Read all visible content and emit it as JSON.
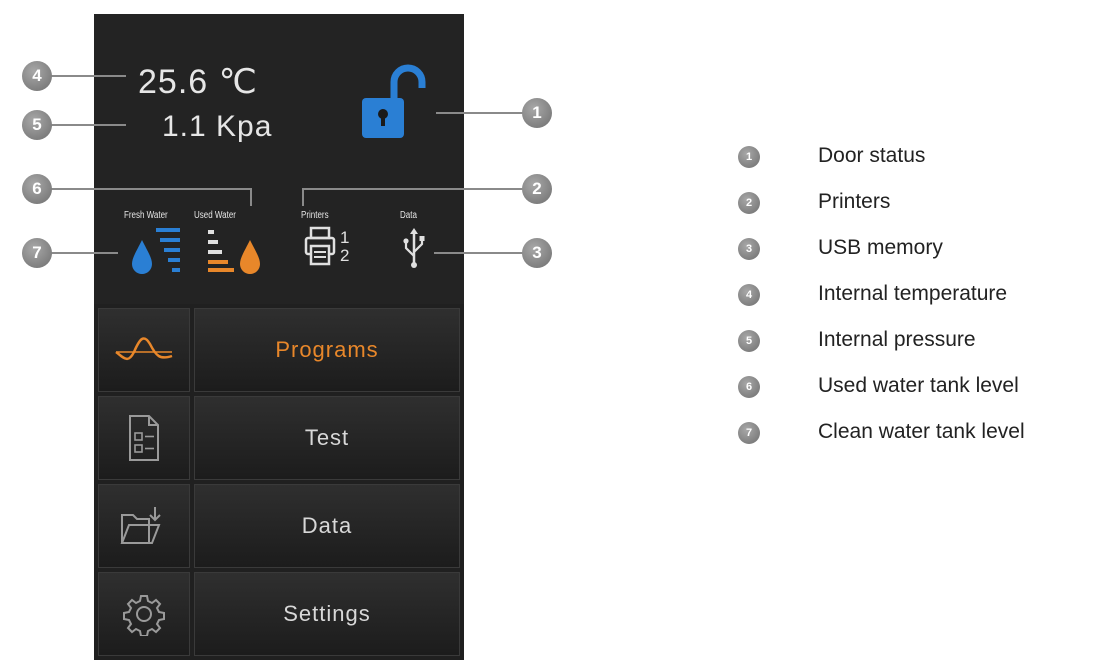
{
  "status": {
    "temperature": "25.6 ℃",
    "pressure": "1.1 Kpa",
    "fresh_water_label": "Fresh Water",
    "used_water_label": "Used Water",
    "printers_label": "Printers",
    "data_label": "Data",
    "printer_num_1": "1",
    "printer_num_2": "2"
  },
  "menu": {
    "items": [
      {
        "label": "Programs",
        "icon": "sine-wave-icon",
        "active": true
      },
      {
        "label": "Test",
        "icon": "checklist-document-icon",
        "active": false
      },
      {
        "label": "Data",
        "icon": "folder-download-icon",
        "active": false
      },
      {
        "label": "Settings",
        "icon": "gear-icon",
        "active": false
      }
    ]
  },
  "callouts": {
    "c1": "1",
    "c2": "2",
    "c3": "3",
    "c4": "4",
    "c5": "5",
    "c6": "6",
    "c7": "7"
  },
  "legend": [
    {
      "num": "1",
      "text": "Door status"
    },
    {
      "num": "2",
      "text": "Printers"
    },
    {
      "num": "3",
      "text": "USB memory"
    },
    {
      "num": "4",
      "text": "Internal temperature"
    },
    {
      "num": "5",
      "text": "Internal pressure"
    },
    {
      "num": "6",
      "text": "Used water tank level"
    },
    {
      "num": "7",
      "text": "Clean water tank level"
    }
  ],
  "colors": {
    "accent_orange": "#e8872a",
    "accent_blue": "#2a7fd4",
    "panel_bg": "#232323"
  }
}
